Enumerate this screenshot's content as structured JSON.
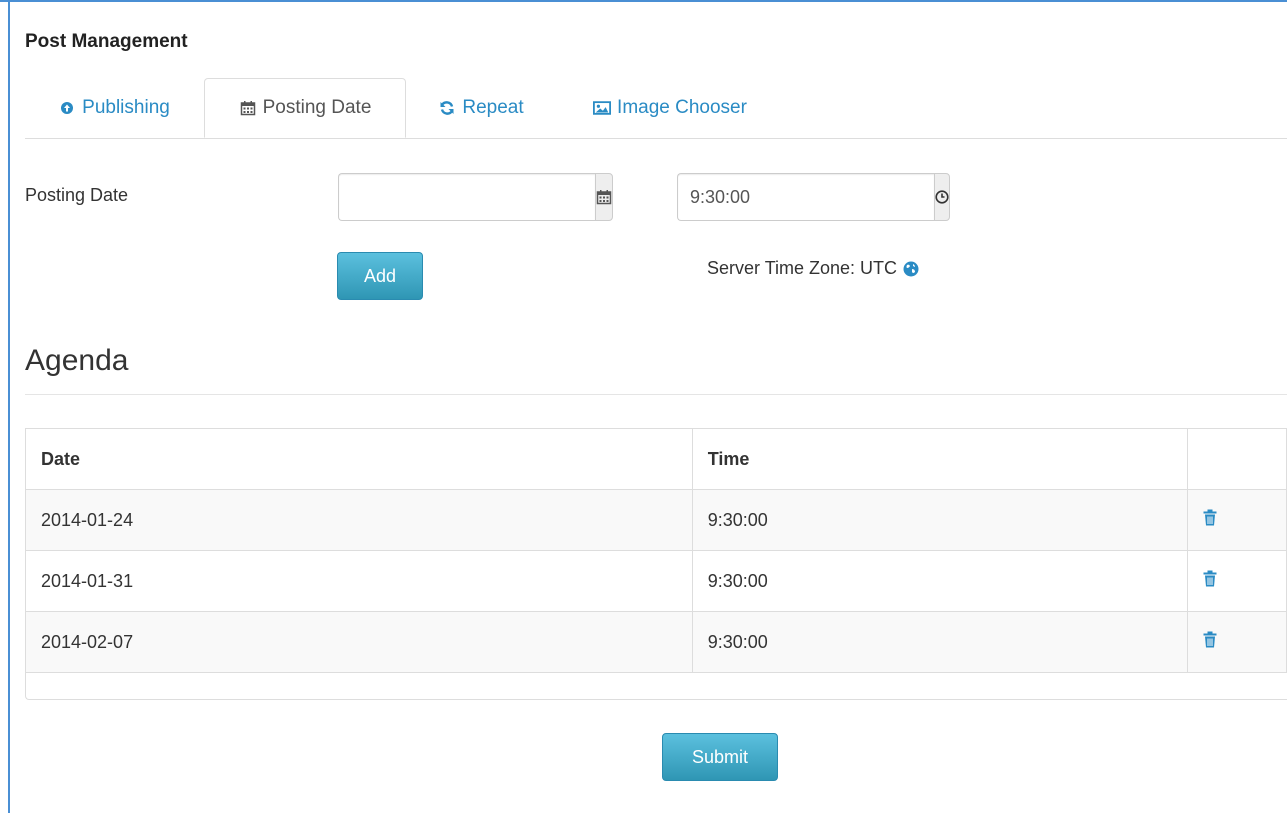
{
  "page": {
    "title": "Post Management"
  },
  "tabs": [
    {
      "label": "Publishing",
      "icon": "circle-arrow-up-icon",
      "active": false
    },
    {
      "label": "Posting Date",
      "icon": "calendar-icon",
      "active": true
    },
    {
      "label": "Repeat",
      "icon": "refresh-icon",
      "active": false
    },
    {
      "label": "Image Chooser",
      "icon": "picture-icon",
      "active": false
    }
  ],
  "form": {
    "posting_date_label": "Posting Date",
    "date_value": "",
    "time_value": "9:30:00",
    "add_label": "Add",
    "timezone_text": "Server Time Zone: UTC"
  },
  "agenda": {
    "heading": "Agenda",
    "columns": [
      "Date",
      "Time",
      ""
    ],
    "rows": [
      {
        "date": "2014-01-24",
        "time": "9:30:00"
      },
      {
        "date": "2014-01-31",
        "time": "9:30:00"
      },
      {
        "date": "2014-02-07",
        "time": "9:30:00"
      }
    ]
  },
  "submit_label": "Submit",
  "colors": {
    "link": "#2a8bc4",
    "primary_button": "#3aa8cc",
    "frame": "#4a8fd4"
  }
}
